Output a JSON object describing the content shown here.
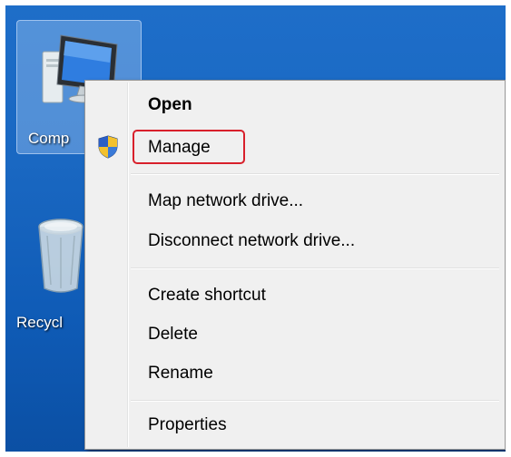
{
  "desktop": {
    "icons": [
      {
        "label": "Comp",
        "icon": "computer-icon"
      },
      {
        "label": "Recycl",
        "icon": "recycle-bin-icon"
      }
    ]
  },
  "context_menu": {
    "items": [
      {
        "label": "Open",
        "bold": true
      },
      {
        "label": "Manage",
        "icon": "uac-shield-icon",
        "highlighted": true
      },
      {
        "label": "Map network drive..."
      },
      {
        "label": "Disconnect network drive..."
      },
      {
        "label": "Create shortcut"
      },
      {
        "label": "Delete"
      },
      {
        "label": "Rename"
      },
      {
        "label": "Properties"
      }
    ]
  },
  "colors": {
    "desktop_blue": "#1a68c2",
    "menu_background": "#f0f0f0",
    "highlight_border": "#d8202b"
  }
}
